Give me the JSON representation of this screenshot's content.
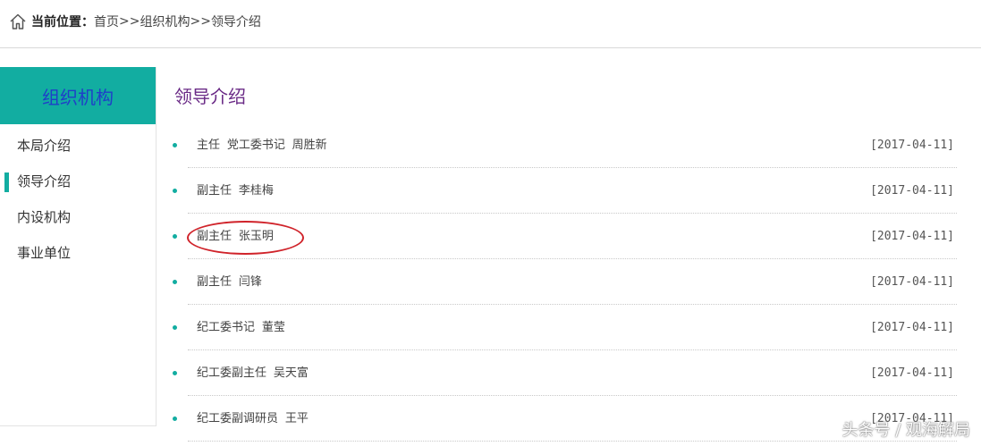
{
  "breadcrumb": {
    "icon": "home-icon",
    "prefix": "当前位置：",
    "home": "首页",
    "separator1": ">>",
    "section": "组织机构",
    "separator2": ">>",
    "current": "领导介绍"
  },
  "sidebar": {
    "title": "组织机构",
    "items": [
      {
        "label": "本局介绍"
      },
      {
        "label": "领导介绍"
      },
      {
        "label": "内设机构"
      },
      {
        "label": "事业单位"
      }
    ],
    "active_index": 1
  },
  "main": {
    "title": "领导介绍",
    "items": [
      {
        "title": "主任 党工委书记 周胜新",
        "date": "[2017-04-11]"
      },
      {
        "title": "副主任 李桂梅",
        "date": "[2017-04-11]"
      },
      {
        "title": "副主任 张玉明",
        "date": "[2017-04-11]"
      },
      {
        "title": "副主任 闫锋",
        "date": "[2017-04-11]"
      },
      {
        "title": "纪工委书记 董莹",
        "date": "[2017-04-11]"
      },
      {
        "title": "纪工委副主任 吴天富",
        "date": "[2017-04-11]"
      },
      {
        "title": "纪工委副调研员 王平",
        "date": "[2017-04-11]"
      }
    ]
  },
  "watermark": "头条号 / 观海解局",
  "colors": {
    "accent": "#12ada1",
    "sidebar_title_text": "#1f3fc8",
    "main_title": "#6a2a86",
    "annotation": "#d0232a"
  }
}
